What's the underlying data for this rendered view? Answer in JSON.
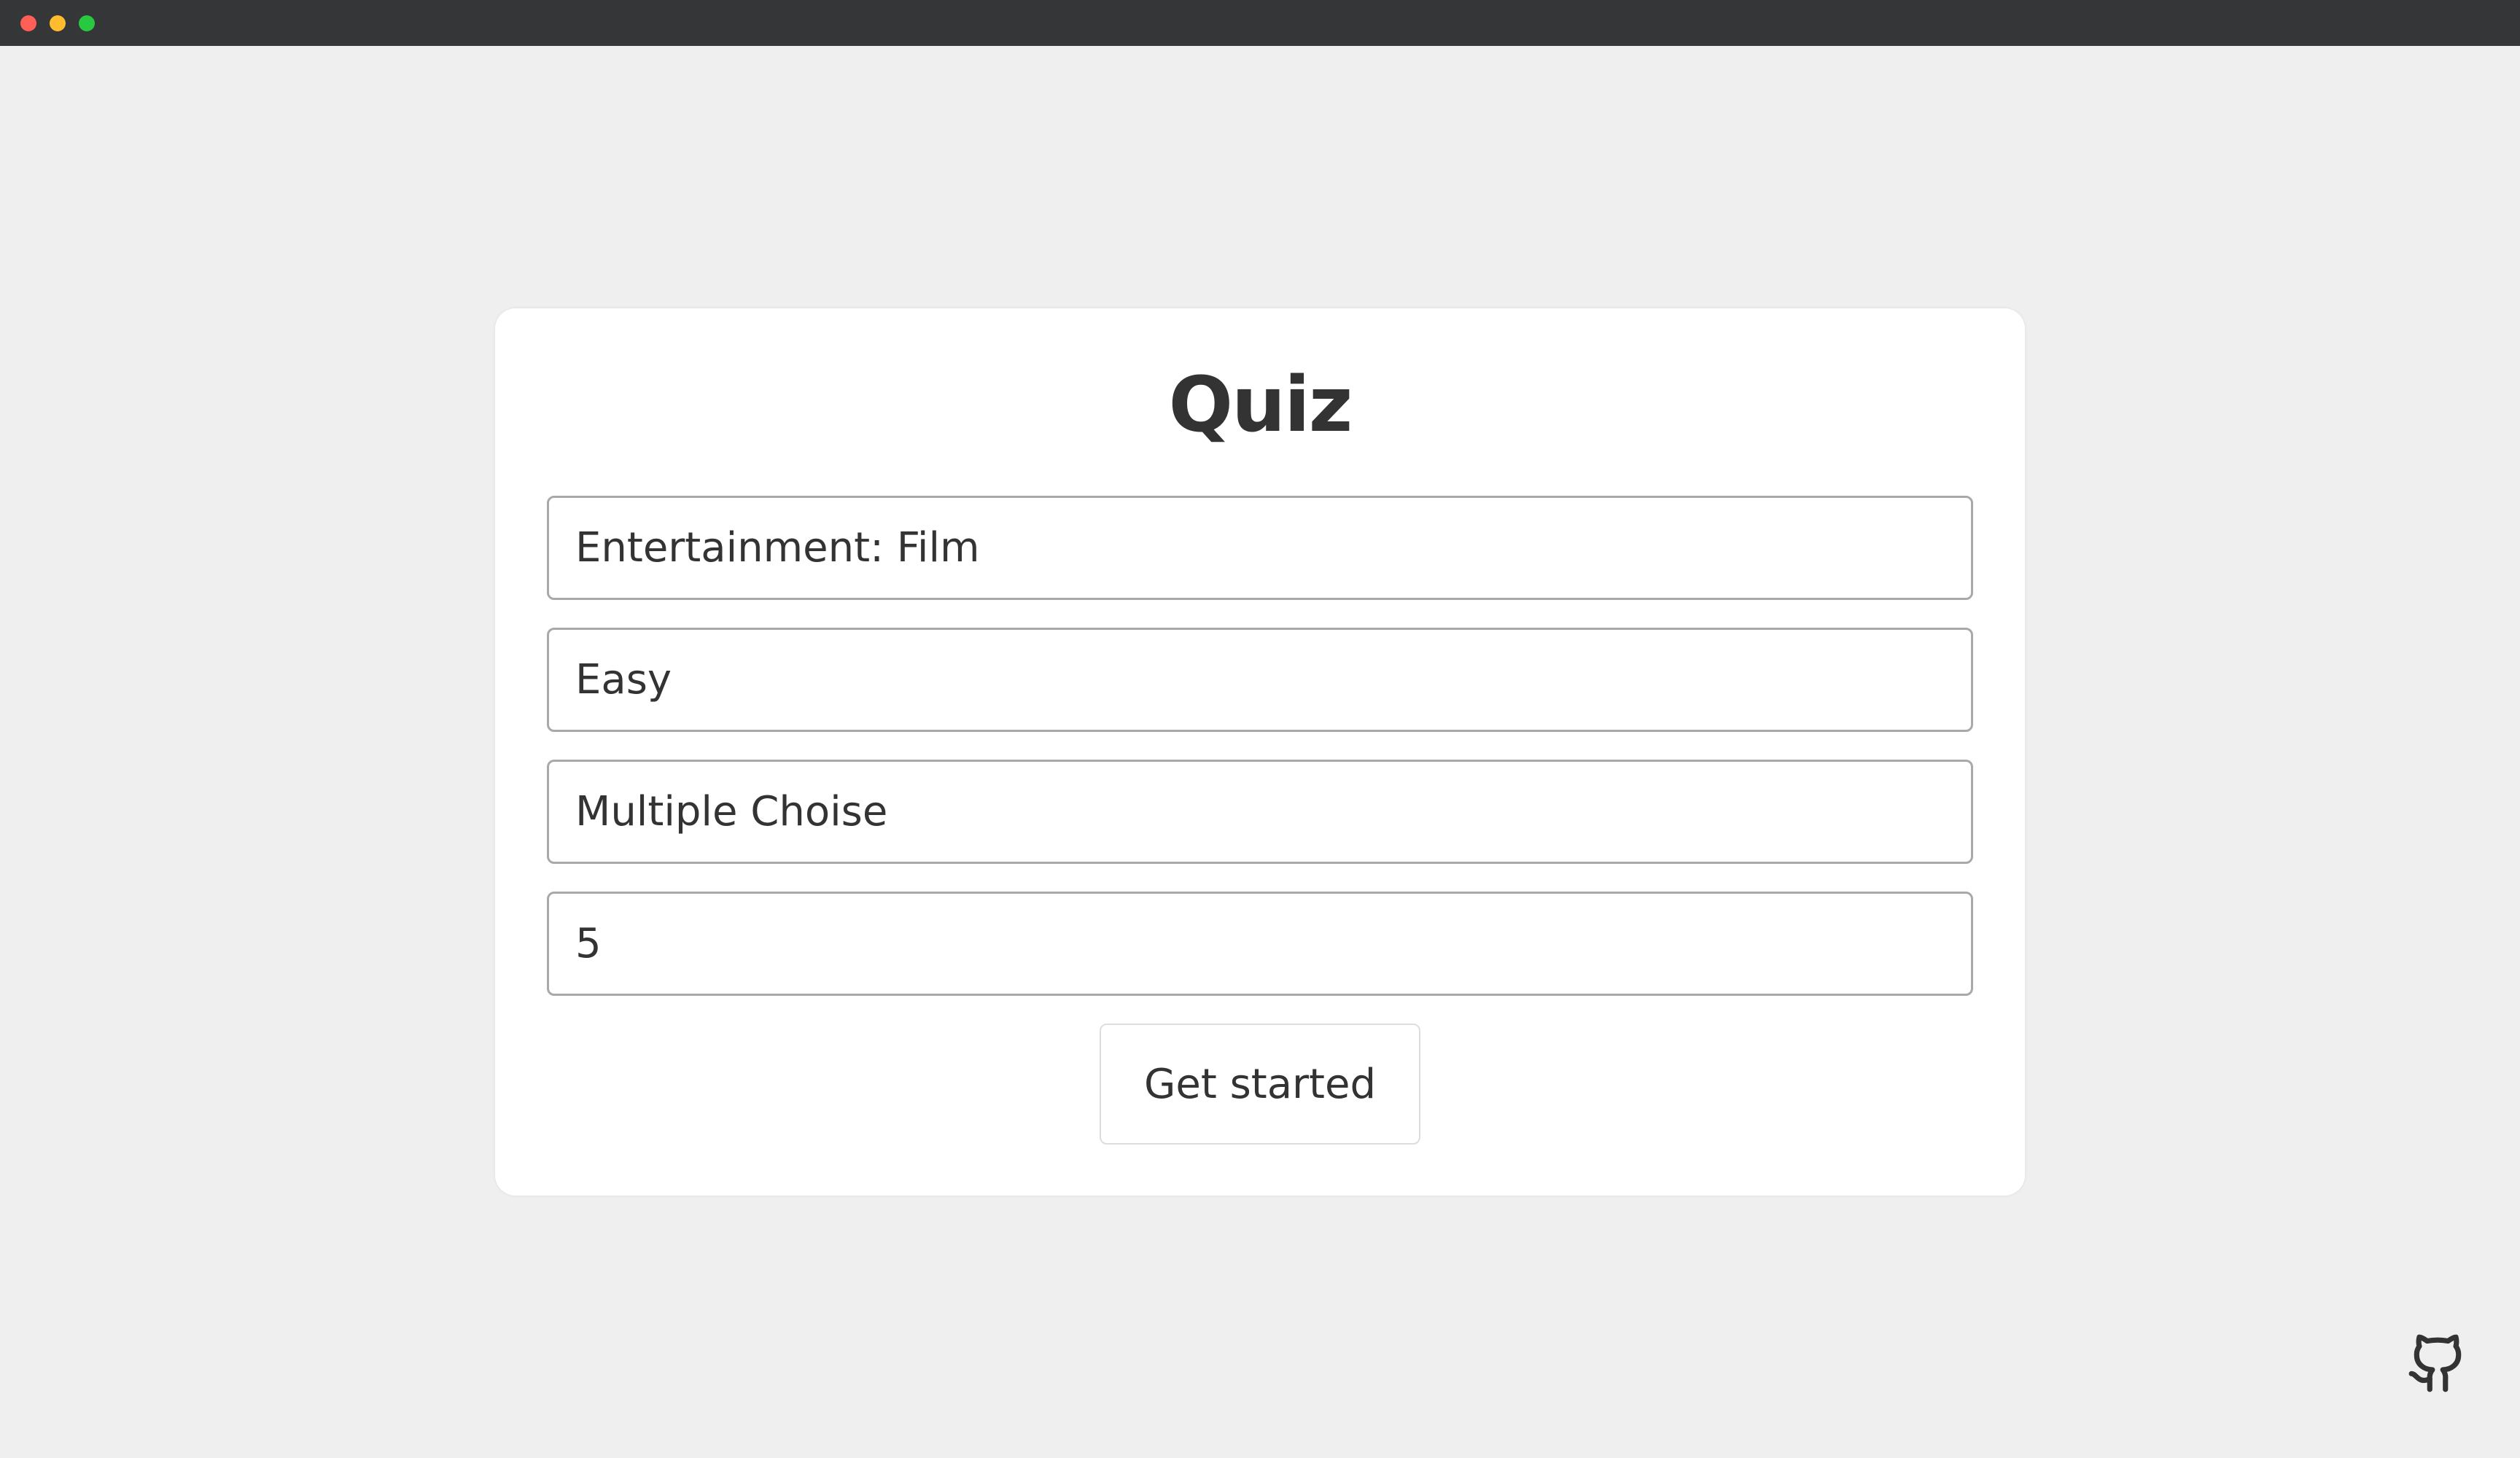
{
  "window": {
    "controls": [
      "close",
      "minimize",
      "maximize"
    ]
  },
  "quiz": {
    "title": "Quiz",
    "fields": {
      "category": "Entertainment: Film",
      "difficulty": "Easy",
      "type": "Multiple Choise",
      "amount": "5"
    },
    "start_button_label": "Get started"
  },
  "footer": {
    "github_icon": "github-icon"
  },
  "colors": {
    "background": "#efefef",
    "card": "#ffffff",
    "text": "#333333",
    "titlebar": "#353638"
  }
}
